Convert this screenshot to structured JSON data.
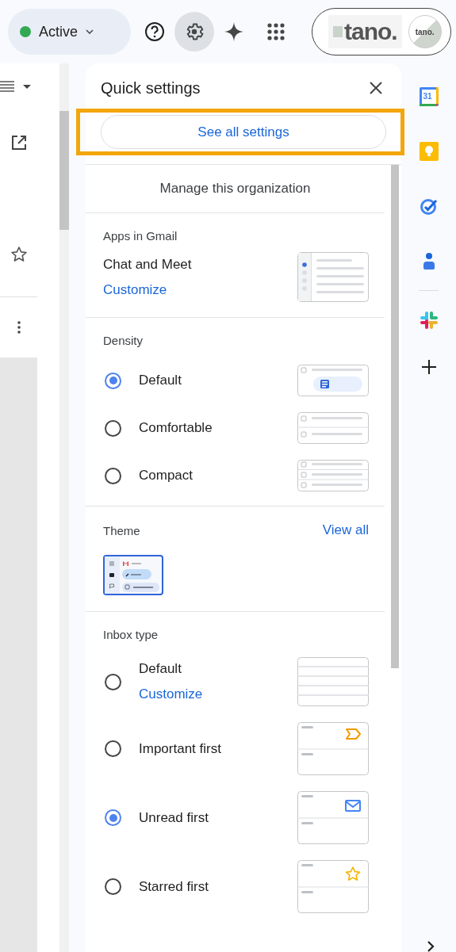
{
  "top_bar": {
    "status": {
      "label": "Active"
    },
    "account": {
      "logo_text": "tano.",
      "avatar_text": "tano."
    }
  },
  "quick_settings": {
    "title": "Quick settings",
    "see_all": "See all settings",
    "manage": "Manage this organization",
    "apps": {
      "heading": "Apps in Gmail",
      "label": "Chat and Meet",
      "link": "Customize"
    },
    "density": {
      "heading": "Density",
      "options": [
        {
          "label": "Default",
          "kind": "default",
          "selected": true
        },
        {
          "label": "Comfortable",
          "kind": "comfortable",
          "selected": false
        },
        {
          "label": "Compact",
          "kind": "compact",
          "selected": false
        }
      ]
    },
    "theme": {
      "heading": "Theme",
      "link": "View all"
    },
    "inbox_type": {
      "heading": "Inbox type",
      "options": [
        {
          "label": "Default",
          "kind": "default",
          "link": "Customize",
          "selected": false
        },
        {
          "label": "Important first",
          "kind": "important",
          "selected": false
        },
        {
          "label": "Unread first",
          "kind": "unread",
          "selected": true
        },
        {
          "label": "Starred first",
          "kind": "starred",
          "selected": false
        }
      ]
    }
  },
  "side_rail": {
    "calendar_day": "31"
  }
}
